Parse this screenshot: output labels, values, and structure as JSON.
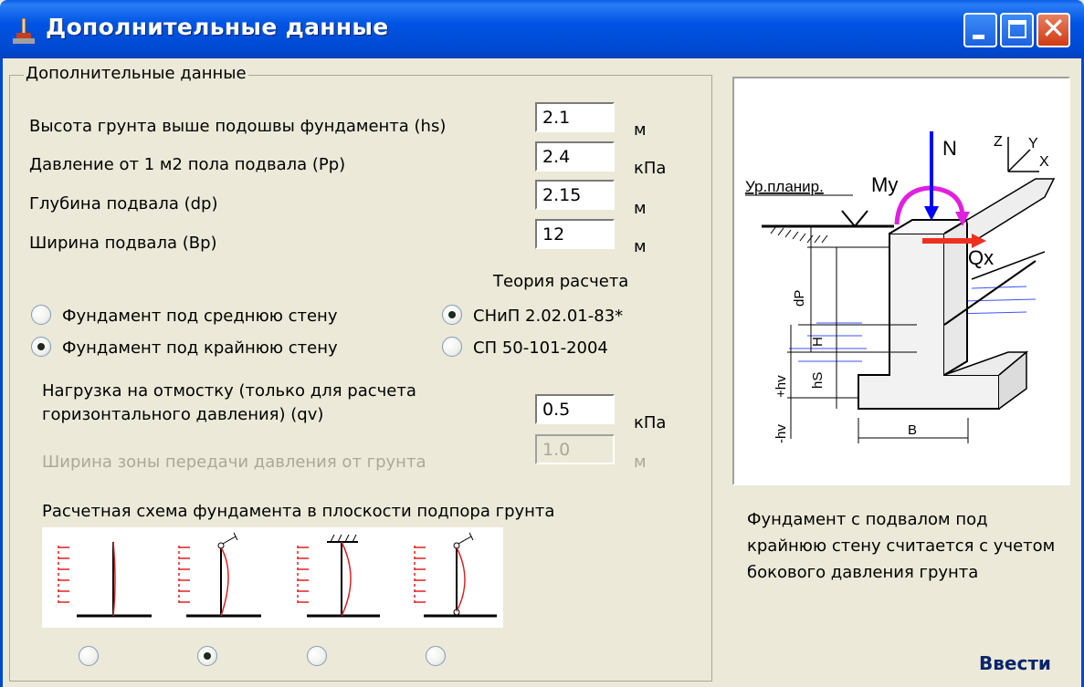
{
  "window": {
    "title": "Дополнительные данные",
    "icon": "app-icon",
    "controls": [
      "minimize-icon",
      "maximize-icon",
      "close-icon"
    ]
  },
  "group": {
    "label": "Дополнительные данные"
  },
  "fields": [
    {
      "label": "Высота грунта выше подошвы фундамента (hs)",
      "value": "2.1",
      "unit": "м"
    },
    {
      "label": "Давление от 1 м2 пола подвала (Pp)",
      "value": "2.4",
      "unit": "кПа"
    },
    {
      "label": "Глубина подвала (dp)",
      "value": "2.15",
      "unit": "м"
    },
    {
      "label": "Ширина подвала (Bp)",
      "value": "12",
      "unit": "м"
    }
  ],
  "theory": {
    "title": "Теория расчета",
    "options": [
      "СНиП 2.02.01-83*",
      "СП 50-101-2004"
    ],
    "selected": 0
  },
  "wall": {
    "options": [
      "Фундамент под среднюю стену",
      "Фундамент под крайнюю стену"
    ],
    "selected": 1
  },
  "load": {
    "label_line1": "Нагрузка на отмостку (только для расчета",
    "label_line2": "горизонтального давления) (qv)",
    "value": "0.5",
    "unit": "кПа"
  },
  "zone": {
    "label": "Ширина зоны передачи давления от грунта",
    "value": "1.0",
    "unit": "м",
    "disabled": true
  },
  "scheme": {
    "label": "Расчетная схема фундамента в плоскости подпора грунта",
    "selected": 1,
    "count": 4
  },
  "diagram_labels": {
    "level": "Ур.планир.",
    "my": "My",
    "n": "N",
    "qx": "Qx",
    "axis_z": "Z",
    "axis_y": "Y",
    "axis_x": "X",
    "dp": "dP",
    "h": "H",
    "hs": "hS",
    "plus_hv": "+hv",
    "minus_hv": "-hv",
    "b": "B"
  },
  "description": "Фундамент с подвалом под крайнюю стену считается с учетом бокового давления грунта",
  "enter_button": "Ввести",
  "colors": {
    "title_blue": "#0054e3",
    "window_bg": "#ece9d8",
    "close_red": "#d03a14",
    "arrow_red": "#e02020",
    "moment_magenta": "#e020e0",
    "force_blue": "#0000ff"
  }
}
